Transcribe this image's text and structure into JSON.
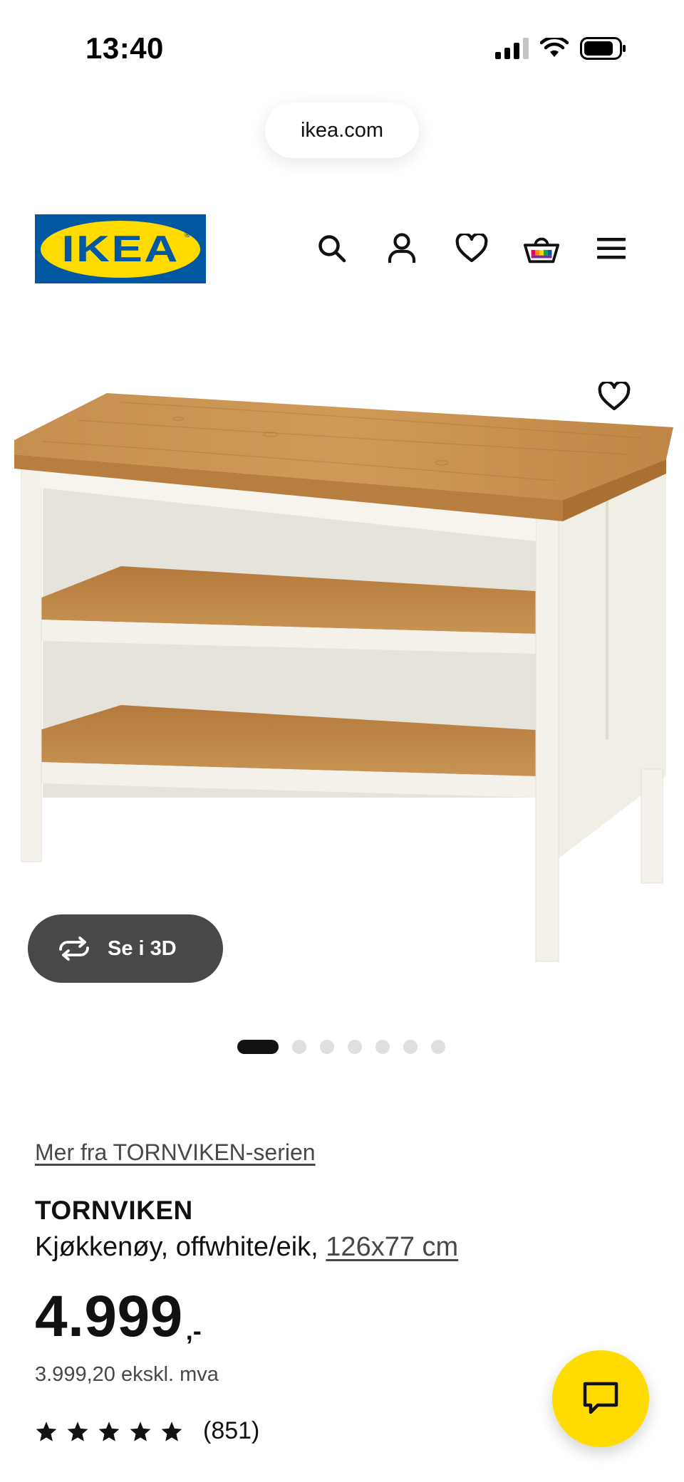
{
  "status_bar": {
    "time": "13:40"
  },
  "browser": {
    "url": "ikea.com"
  },
  "header": {
    "logo_text": "IKEA",
    "icons": [
      "search-icon",
      "account-icon",
      "favourites-icon",
      "basket-icon",
      "menu-icon"
    ]
  },
  "gallery": {
    "view_3d_label": "Se i 3D",
    "image_count": 7,
    "active_index": 0
  },
  "product": {
    "series_link": "Mer fra TORNVIKEN-serien",
    "name": "TORNVIKEN",
    "description": "Kjøkkenøy, offwhite/eik, ",
    "dimension_link": "126x77 cm",
    "price": "4.999",
    "price_suffix": ",-",
    "price_ex_vat": "3.999,20 ekskl. mva",
    "rating_stars": 5,
    "review_count": "(851)"
  },
  "colors": {
    "ikea_blue": "#0058a3",
    "ikea_yellow": "#ffdb00",
    "pill_dark": "#484848"
  }
}
